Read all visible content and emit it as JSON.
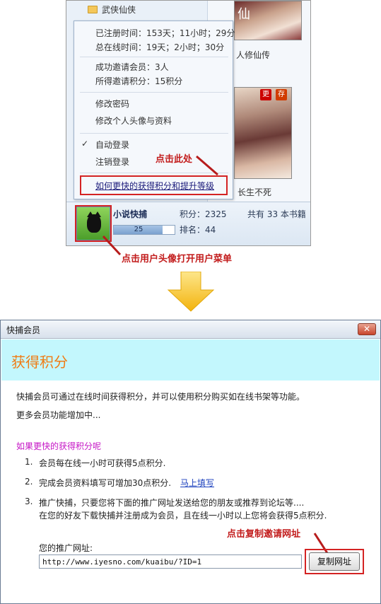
{
  "top": {
    "tree_item": "武侠仙侠",
    "books": [
      {
        "title": "人修仙传",
        "tag": ""
      },
      {
        "title": "长生不死",
        "tag": "更",
        "tag2": "存"
      }
    ],
    "cover1_text": "仙",
    "menu": {
      "registered_time": "已注册时间：153天；11小时；29分",
      "online_time": "总在线时间：19天；2小时；30分",
      "invited": "成功邀请会员：3人",
      "invite_points": "所得邀请积分：15积分",
      "change_password": "修改密码",
      "edit_profile": "修改个人头像与资料",
      "check_mark": "✓",
      "auto_login": "自动登录",
      "logout": "注销登录",
      "help_link": "如何更快的获得积分和提升等级"
    },
    "callout_menu": "点击此处",
    "callout_avatar": "点击用户头像打开用户菜单",
    "user": {
      "name": "小说快捕",
      "level": "25",
      "level_progress": 0.8,
      "points": "积分：2325",
      "rank": "排名：44",
      "books": "共有 33 本书籍"
    }
  },
  "dialog": {
    "title": "快捕会员",
    "close_label": "✕",
    "heading": "获得积分",
    "intro": "快捕会员可通过在线时间获得积分，并可以使用积分购买如在线书架等功能。",
    "more": "更多会员功能增加中...",
    "faster_heading": "如果更快的获得积分呢",
    "steps": [
      {
        "num": "1.",
        "text": "会员每在线一小时可获得5点积分."
      },
      {
        "num": "2.",
        "text": "完成会员资料填写可增加30点积分.",
        "link": "马上填写"
      },
      {
        "num": "3.",
        "text": "推广快捕，只要您将下面的推广网址发送给您的朋友或推荐到论坛等....",
        "text2": "在您的好友下载快捕并注册成为会员，且在线一小时以上您将会获得5点积分."
      }
    ],
    "callout_copy": "点击复制邀请网址",
    "url_label": "您的推广网址:",
    "url_value": "http://www.iyesno.com/kuaibu/?ID=1",
    "copy_button": "复制网址"
  },
  "colors": {
    "accent_orange": "#f07b13",
    "header_band": "#c3f7fd",
    "callout_red": "#c21b1b",
    "magenta": "#c514c5",
    "arrow_yellow": "#f7c218"
  }
}
